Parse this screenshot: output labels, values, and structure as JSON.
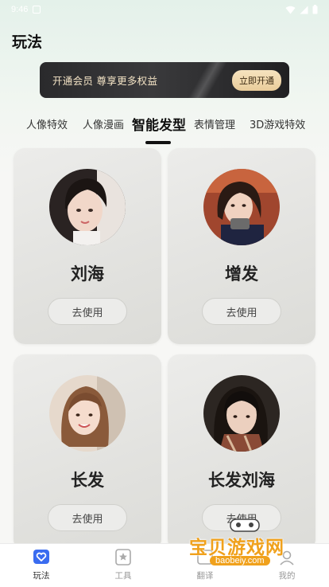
{
  "status_bar": {
    "time": "9:46"
  },
  "page_title": "玩法",
  "banner": {
    "text": "开通会员  尊享更多权益",
    "button": "立即开通"
  },
  "tabs": [
    {
      "label": "人像特效",
      "active": false
    },
    {
      "label": "人像漫画",
      "active": false
    },
    {
      "label": "智能发型",
      "active": true
    },
    {
      "label": "表情管理",
      "active": false
    },
    {
      "label": "3D游戏特效",
      "active": false
    }
  ],
  "cards": [
    {
      "title": "刘海",
      "button": "去使用"
    },
    {
      "title": "增发",
      "button": "去使用"
    },
    {
      "title": "长发",
      "button": "去使用"
    },
    {
      "title": "长发刘海",
      "button": "去使用"
    }
  ],
  "bottom_nav": [
    {
      "label": "玩法",
      "icon": "heart-chat-icon",
      "active": true
    },
    {
      "label": "工具",
      "icon": "star-bookmark-icon",
      "active": false
    },
    {
      "label": "翻译",
      "icon": "translate-icon",
      "active": false
    },
    {
      "label": "我的",
      "icon": "profile-icon",
      "active": false
    }
  ],
  "watermark": {
    "text": "宝贝游戏网",
    "url": "baobeiy.com"
  },
  "colors": {
    "accent": "#3a6cf0",
    "gold": "#f2e2c4",
    "watermark": "#f0a11c"
  }
}
